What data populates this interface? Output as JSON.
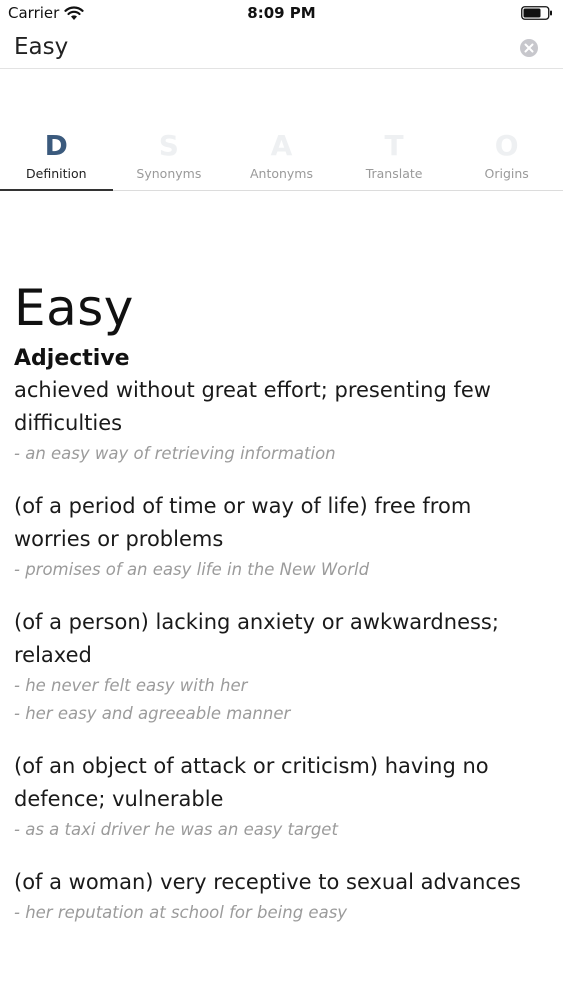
{
  "status_bar": {
    "carrier": "Carrier",
    "time": "8:09 PM"
  },
  "search": {
    "value": "Easy",
    "placeholder": ""
  },
  "tabs": [
    {
      "letter": "D",
      "label": "Definition",
      "active": true
    },
    {
      "letter": "S",
      "label": "Synonyms",
      "active": false
    },
    {
      "letter": "A",
      "label": "Antonyms",
      "active": false
    },
    {
      "letter": "T",
      "label": "Translate",
      "active": false
    },
    {
      "letter": "O",
      "label": "Origins",
      "active": false
    }
  ],
  "entry": {
    "word": "Easy",
    "part_of_speech": "Adjective",
    "senses": [
      {
        "definition": "achieved without great effort; presenting few difficulties",
        "examples": [
          "an easy way of retrieving information"
        ]
      },
      {
        "definition": "(of a period of time or way of life) free from worries or problems",
        "examples": [
          "promises of an easy life in the New World"
        ]
      },
      {
        "definition": "(of a person) lacking anxiety or awkwardness; relaxed",
        "examples": [
          "he never felt easy with her",
          "her easy and agreeable manner"
        ]
      },
      {
        "definition": "(of an object of attack or criticism) having no defence; vulnerable",
        "examples": [
          "as a taxi driver he was an easy target"
        ]
      },
      {
        "definition": "(of a woman) very receptive to sexual advances",
        "examples": [
          "her reputation at school for being easy"
        ]
      }
    ]
  },
  "colors": {
    "accent": "#3b5a7d",
    "inactive_letter": "#eef0f2",
    "example_text": "#9b9b9b"
  },
  "icons": {
    "wifi": "wifi-icon",
    "battery": "battery-icon",
    "clear": "clear-icon"
  }
}
